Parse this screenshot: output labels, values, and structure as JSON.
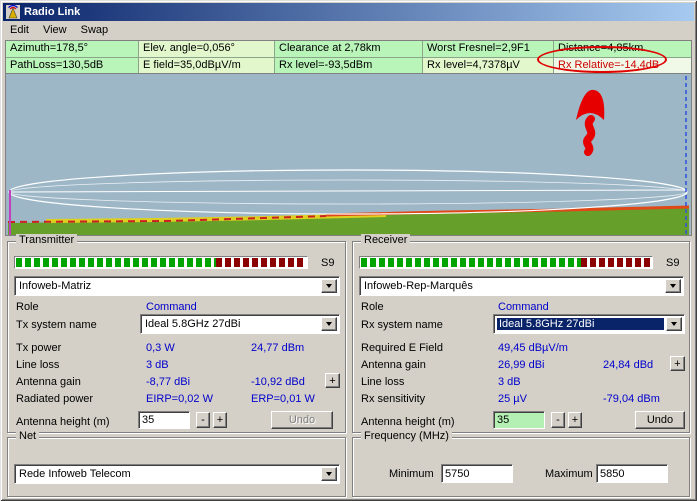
{
  "window": {
    "title": "Radio Link"
  },
  "menu": {
    "items": [
      "Edit",
      "View",
      "Swap"
    ]
  },
  "info_bar": {
    "row1": [
      "Azimuth=178,5°",
      "Elev. angle=0,056°",
      "Clearance at 2,78km",
      "Worst Fresnel=2,9F1",
      "Distance=4,85km"
    ],
    "row2": [
      "PathLoss=130,5dB",
      "E field=35,0dBµV/m",
      "Rx level=-93,5dBm",
      "Rx level=4,7378µV",
      "Rx Relative=-14,4dB"
    ]
  },
  "chart": {
    "description": "Terrain elevation profile between transmitter and receiver with white Fresnel zone ellipse, line-of-sight line, terrain colored green/yellow/red",
    "annotations": [
      "hand-drawn red arrow pointing up over profile",
      "red ellipse circling Rx Relative=-14,4dB value"
    ]
  },
  "transmitter": {
    "group_label": "Transmitter",
    "meter_label": "S9",
    "unit_combo": "Infoweb-Matriz",
    "role_label": "Role",
    "role_value": "Command",
    "system_label": "Tx system name",
    "system_combo": "Ideal 5.8GHz 27dBi",
    "power_label": "Tx power",
    "power_w": "0,3 W",
    "power_dbm": "24,77 dBm",
    "line_loss_label": "Line loss",
    "line_loss_value": "3 dB",
    "gain_label": "Antenna gain",
    "gain_dbi": "-8,77 dBi",
    "gain_dbd": "-10,92 dBd",
    "gain_plus": "+",
    "radiated_label": "Radiated power",
    "eirp": "EIRP=0,02 W",
    "erp": "ERP=0,01 W",
    "height_label": "Antenna height (m)",
    "height_value": "35",
    "minus": "-",
    "plus": "+",
    "undo": "Undo"
  },
  "receiver": {
    "group_label": "Receiver",
    "meter_label": "S9",
    "unit_combo": "Infoweb-Rep-Marquês",
    "role_label": "Role",
    "role_value": "Command",
    "system_label": "Rx system name",
    "system_combo": "Ideal 5.8GHz 27dBi",
    "efield_label": "Required E Field",
    "efield_value": "49,45 dBµV/m",
    "gain_label": "Antenna gain",
    "gain_dbi": "26,99 dBi",
    "gain_dbd": "24,84 dBd",
    "gain_plus": "+",
    "line_loss_label": "Line loss",
    "line_loss_value": "3 dB",
    "sens_label": "Rx sensitivity",
    "sens_uv": "25 µV",
    "sens_dbm": "-79,04 dBm",
    "height_label": "Antenna height (m)",
    "height_value": "35",
    "minus": "-",
    "plus": "+",
    "undo": "Undo"
  },
  "net": {
    "group_label": "Net",
    "combo": "Rede Infoweb Telecom"
  },
  "frequency": {
    "group_label": "Frequency (MHz)",
    "min_label": "Minimum",
    "min_value": "5750",
    "max_label": "Maximum",
    "max_value": "5850"
  },
  "colors": {
    "titlebar_left": "#0a246a",
    "titlebar_right": "#a6caf0",
    "window_bg": "#d4d0c8",
    "info_green": "#b9f4b9",
    "info_pale": "#e3f7cc",
    "value_blue": "#0000cc",
    "alert_red": "#cc0000",
    "annotation_red": "#e00000",
    "chart_sky": "#9db7c7",
    "terrain_green": "#66a02a",
    "terrain_yellow": "#ddd020",
    "terrain_red": "#e04818",
    "meter_green": "#00a400",
    "meter_red": "#8b0000",
    "height_highlight": "#b4f0b4",
    "selection_blue": "#0a246a"
  }
}
